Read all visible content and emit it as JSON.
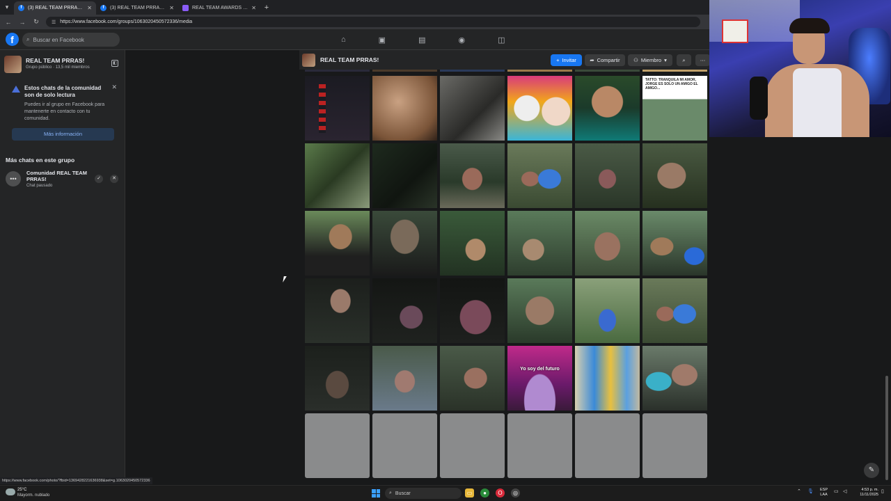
{
  "browser": {
    "tabs": [
      {
        "title": "(3) REAL TEAM PRRAS! | Facebo",
        "icon": "facebook-icon",
        "active": true
      },
      {
        "title": "(3) REAL TEAM PRRAS! | PRE-N",
        "icon": "facebook-icon",
        "active": false
      },
      {
        "title": "REAL TEAM AWARDS (Pre-nom",
        "icon": "forms-icon",
        "active": false
      }
    ],
    "url": "https://www.facebook.com/groups/1063020450572336/media",
    "status_url": "https://www.facebook.com/photo/?fbid=1369428221636938&set=g.1063020450572336"
  },
  "facebook": {
    "search_placeholder": "Buscar en Facebook",
    "nav_icons": [
      "home-icon",
      "video-icon",
      "marketplace-icon",
      "groups-icon",
      "gaming-icon"
    ]
  },
  "group": {
    "name": "REAL TEAM PRRAS!",
    "subtitle": "Grupo público · 13,5 mil miembros",
    "actions": {
      "invite": "Invitar",
      "share": "Compartir",
      "member": "Miembro"
    }
  },
  "sidebar": {
    "notice": {
      "title": "Estos chats de la comunidad son de solo lectura",
      "body": "Puedes ir al grupo en Facebook para mantenerte en contacto con tu comunidad.",
      "button": "Más información"
    },
    "more_chats_title": "Más chats en este grupo",
    "chats": [
      {
        "name": "Comunidad REAL TEAM PRRAS!",
        "status": "Chat pausado"
      }
    ]
  },
  "media": {
    "captions": {
      "tattoo": "TATTO: TRANQUILA MI AMOR, JORGE ES SOLO UN AMIGO EL AMIGO...",
      "futuro": "Yo soy del futuro"
    }
  },
  "taskbar": {
    "temperature": "25°C",
    "weather": "Mayorm. nublado",
    "search": "Buscar",
    "lang_top": "ESP",
    "lang_bottom": "LAA",
    "time": "4:53 p. m.",
    "date": "11/11/2025"
  },
  "colors": {
    "fb_blue": "#1877f2",
    "background": "#18191a",
    "panel": "#242526"
  }
}
